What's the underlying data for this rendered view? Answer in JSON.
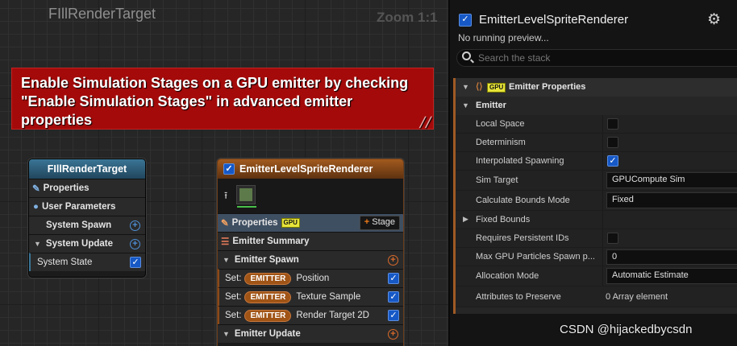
{
  "graph": {
    "title": "FIllRenderTarget",
    "zoom": "Zoom 1:1",
    "banner": "Enable Simulation Stages on a GPU emitter by checking \"Enable Simulation Stages\" in advanced emitter properties"
  },
  "system_node": {
    "title": "FIllRenderTarget",
    "rows": {
      "properties": "Properties",
      "user_parameters": "User Parameters",
      "system_spawn": "System Spawn",
      "system_update": "System Update",
      "system_state": "System State"
    }
  },
  "emitter_node": {
    "title": "EmitterLevelSpriteRenderer",
    "properties": "Properties",
    "gpu_badge": "GPU",
    "stage_button": "Stage",
    "emitter_summary": "Emitter Summary",
    "emitter_spawn": "Emitter Spawn",
    "set_label": "Set:",
    "emitter_pill": "EMITTER",
    "modules": [
      "Position",
      "Texture Sample",
      "Render Target 2D"
    ],
    "emitter_update": "Emitter Update"
  },
  "details": {
    "title": "EmitterLevelSpriteRenderer",
    "subtitle": "No running preview...",
    "search_placeholder": "Search the stack",
    "section_header": "Emitter Properties",
    "gpu_badge": "GPU",
    "group": "Emitter",
    "props": {
      "local_space": "Local Space",
      "determinism": "Determinism",
      "interpolated_spawning": "Interpolated Spawning",
      "sim_target": "Sim Target",
      "sim_target_value": "GPUCompute Sim",
      "calc_bounds_mode": "Calculate Bounds Mode",
      "calc_bounds_value": "Fixed",
      "fixed_bounds": "Fixed Bounds",
      "requires_persistent_ids": "Requires Persistent IDs",
      "max_gpu_spawn": "Max GPU Particles Spawn p...",
      "max_gpu_spawn_value": "0",
      "allocation_mode": "Allocation Mode",
      "allocation_mode_value": "Automatic Estimate",
      "attributes_to_preserve": "Attributes to Preserve",
      "attributes_value": "0 Array element"
    }
  },
  "watermark": "CSDN @hijackedbycsdn",
  "colors": {
    "emitter_accent": "#a05416",
    "system_header": "#3a7595",
    "banner": "#a40a0a",
    "checkbox": "#1658c6"
  }
}
